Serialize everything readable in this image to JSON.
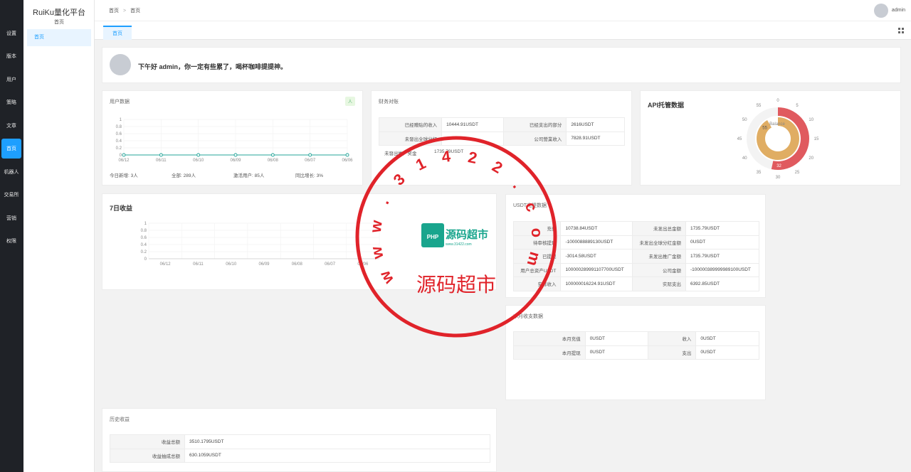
{
  "app": {
    "brand": "RuiKu量化平台",
    "subtitle": "首页"
  },
  "rail": [
    "设置",
    "版本",
    "用户",
    "策略",
    "文章",
    "首页",
    "机器人",
    "交易所",
    "营销",
    "权限"
  ],
  "subnav": {
    "item": "首页"
  },
  "topbar": {
    "crumb_home": "首页",
    "crumb_sep": ">",
    "crumb_current": "首页",
    "username": "admin"
  },
  "tabs": {
    "active": "首页"
  },
  "greeting": "下午好 admin，你一定有些累了，喝杯咖啡提提神。",
  "user_data": {
    "title": "用户数据",
    "badge": "人",
    "stats": [
      "今日新增: 3人",
      "全部: 289人",
      "激活用户: 85人",
      "同比增长: 3%"
    ]
  },
  "finance": {
    "title": "财务对账",
    "rows": [
      [
        "已经赠贴的收入",
        "10444.91USDT",
        "已经支出的部分",
        "2616USDT"
      ],
      [
        "未發出全球分红",
        "",
        "公司營業收入",
        "7828.91USDT"
      ]
    ],
    "extra_label": "未發出推广奖金",
    "extra_value": "1735.79USDT"
  },
  "api": {
    "title": "API托管数据",
    "center_label": "Balance",
    "inner_value": "55",
    "outer_value": "32"
  },
  "income7": {
    "title": "7日收益"
  },
  "usdt": {
    "title": "USDT充提数据",
    "rows": [
      [
        "充值",
        "10738.84USDT",
        "未发出总金额",
        "1735.79USDT"
      ],
      [
        "待审核提现",
        "-1000088889130USDT",
        "未发出全球分红金额",
        "0USDT"
      ],
      [
        "已提现",
        "-3014.58USDT",
        "未发出推广金额",
        "1735.79USDT"
      ],
      [
        "用户总资产USDT",
        "100000289991107700USDT",
        "公司金额",
        "-100000389999989100USDT"
      ],
      [
        "实际收入",
        "100000016224.91USDT",
        "实际支出",
        "6392.85USDT"
      ]
    ]
  },
  "monthly": {
    "title": "本月收支数据",
    "rows": [
      [
        "本月充值",
        "0USDT",
        "收入",
        "0USDT"
      ],
      [
        "本月提现",
        "0USDT",
        "支出",
        "0USDT"
      ]
    ]
  },
  "history": {
    "title": "历史收益",
    "rows": [
      [
        "收益总额",
        "3510.1795USDT"
      ],
      [
        "收益抽成总额",
        "630.1059USDT"
      ]
    ]
  },
  "watermark": {
    "url": "www.31422.com",
    "name": "源码超市",
    "logo": "源码超市",
    "logo_sub": "www.31422.com"
  },
  "chart_data": [
    {
      "type": "line",
      "title": "用户数据",
      "categories": [
        "06/12",
        "06/11",
        "06/10",
        "06/09",
        "06/08",
        "06/07",
        "06/06"
      ],
      "values": [
        0,
        0,
        0,
        0,
        0,
        0,
        0
      ],
      "yticks": [
        "0",
        "0.2",
        "0.4",
        "0.6",
        "0.8",
        "1"
      ],
      "ylim": [
        0,
        1
      ],
      "color": "#26a69a"
    },
    {
      "type": "line",
      "title": "7日收益",
      "categories": [
        "06/12",
        "06/11",
        "06/10",
        "06/09",
        "06/08",
        "06/07",
        "06/06"
      ],
      "values": [],
      "yticks": [
        "0",
        "0.2",
        "0.4",
        "0.6",
        "0.8",
        "1"
      ],
      "ylim": [
        0,
        1
      ]
    },
    {
      "type": "gauge",
      "title": "API托管数据",
      "ticks": [
        "0",
        "5",
        "10",
        "15",
        "20",
        "25",
        "30",
        "35",
        "40",
        "45",
        "50",
        "55"
      ],
      "series": [
        {
          "name": "Balance",
          "value": 32,
          "color": "#e05a5f"
        },
        {
          "name": "",
          "value": 55,
          "color": "#e0ad63"
        }
      ],
      "max": 60
    }
  ]
}
